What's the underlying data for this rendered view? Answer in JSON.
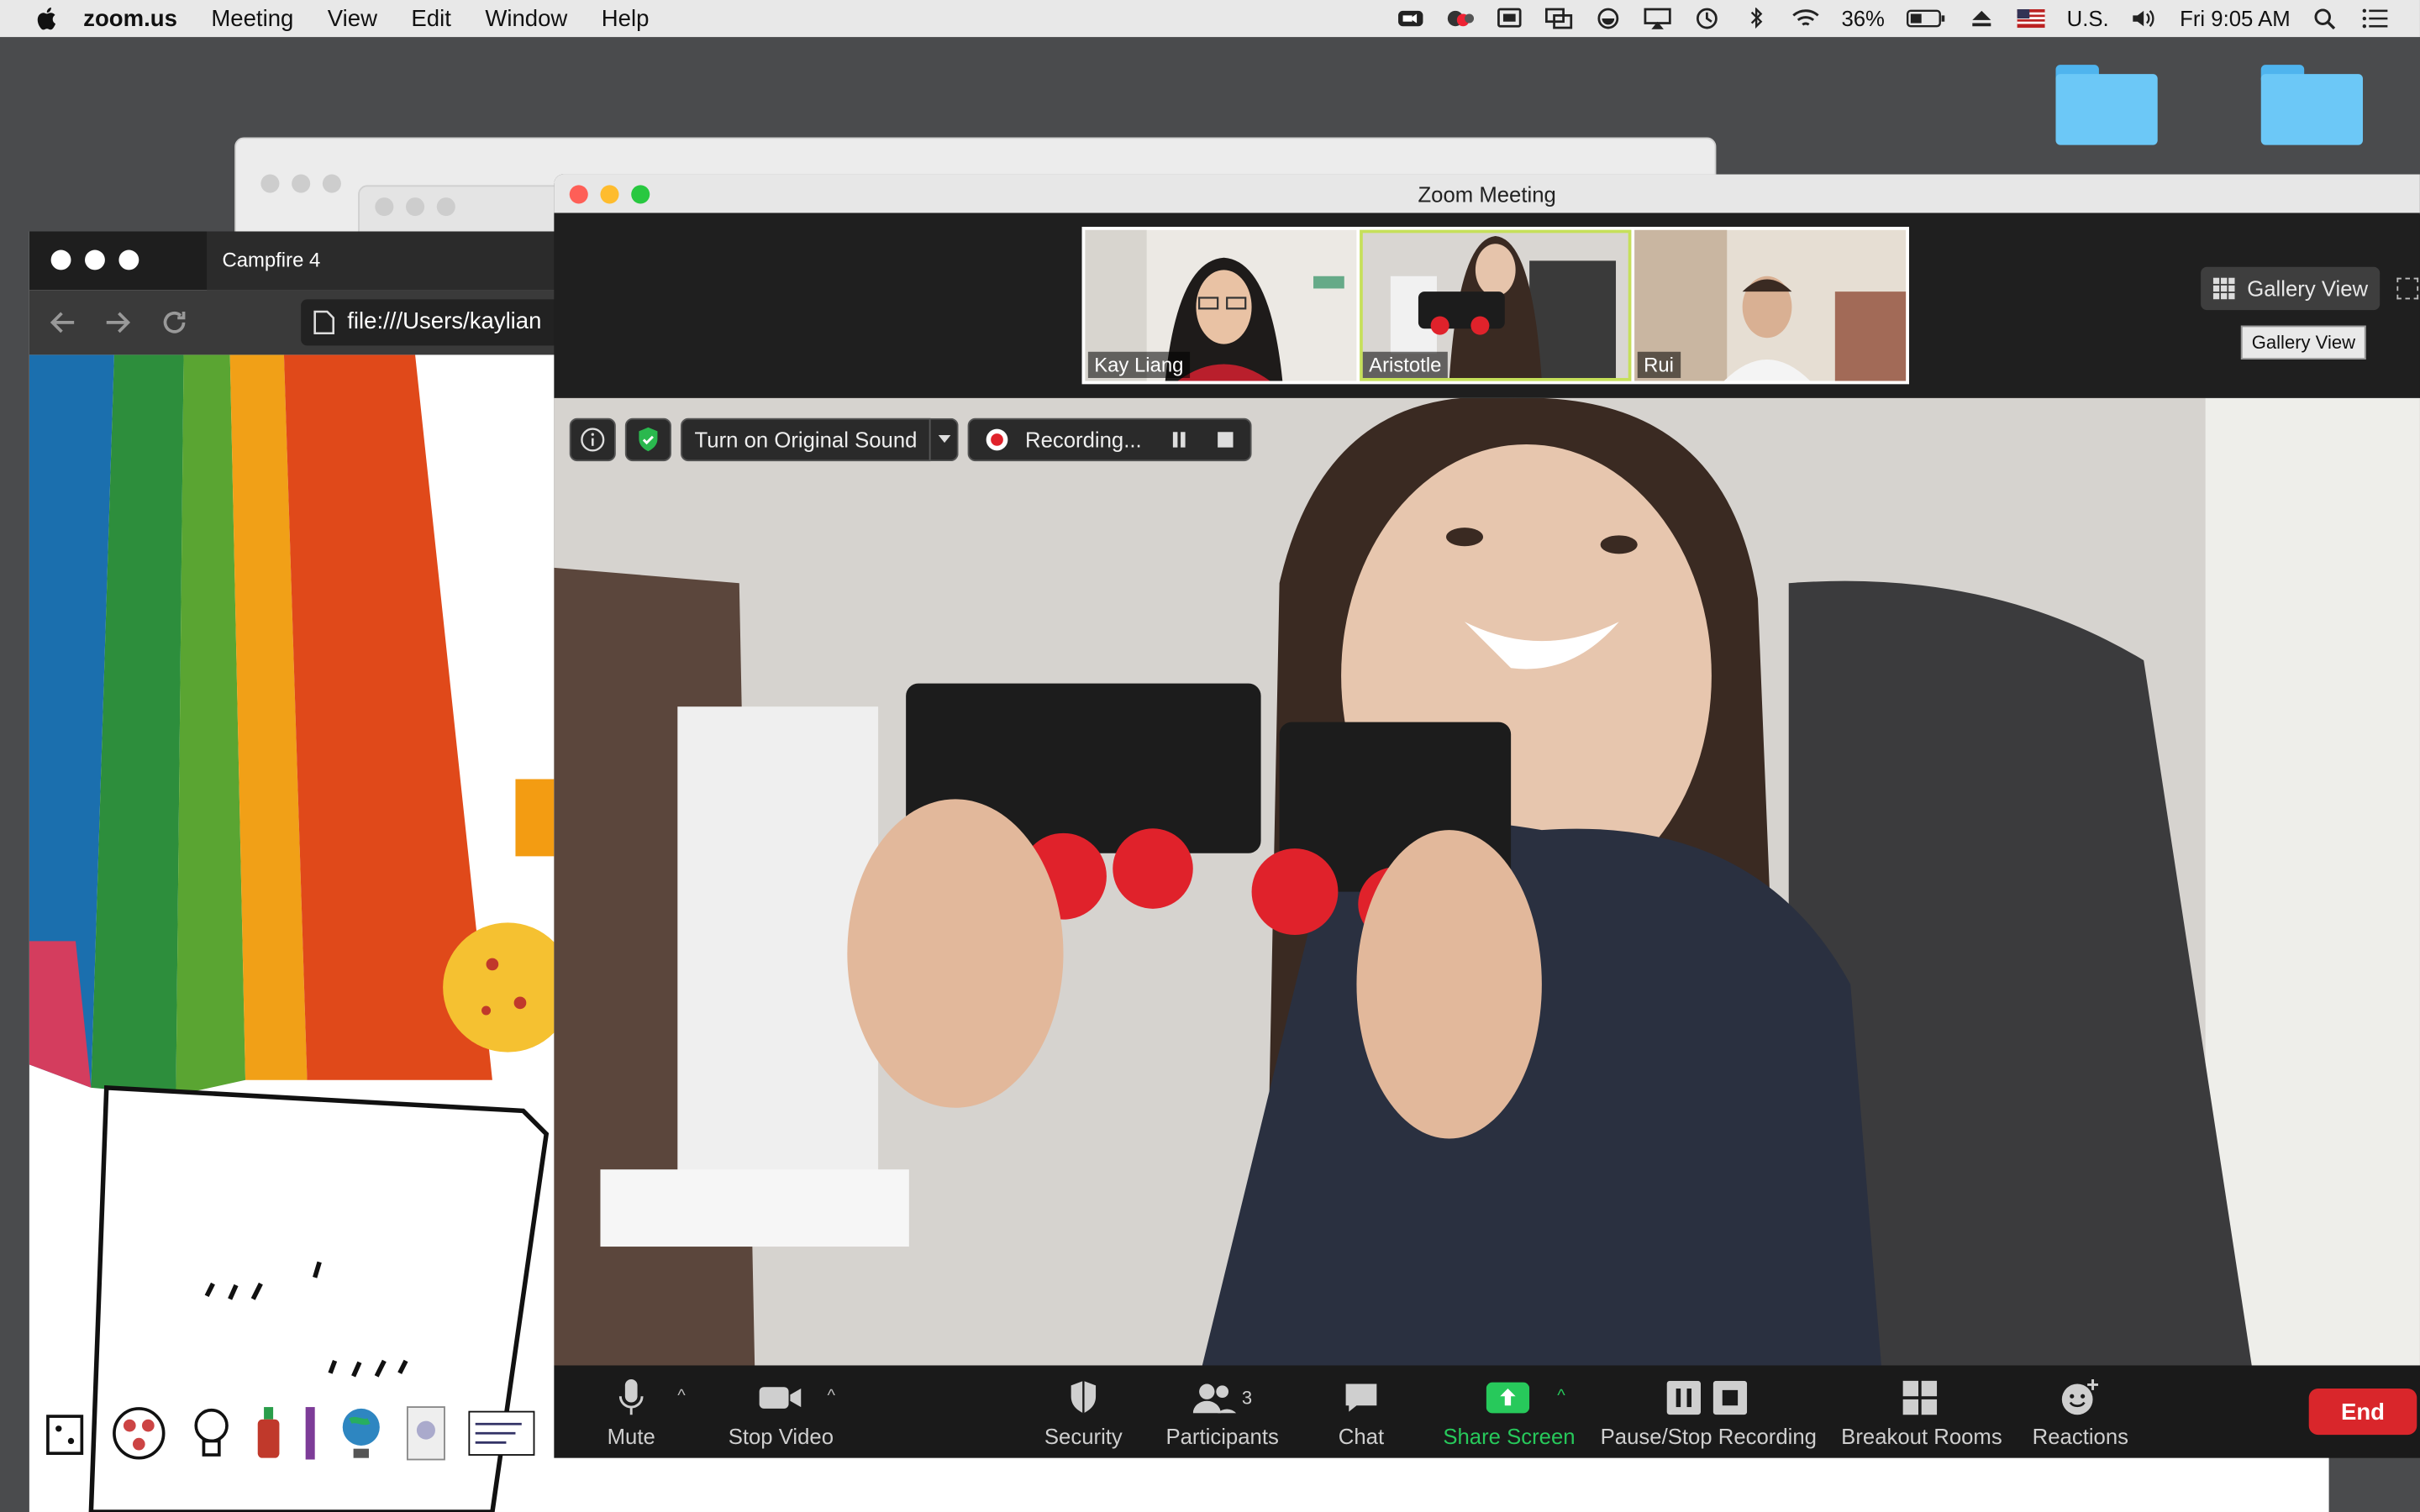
{
  "menubar": {
    "app": "zoom.us",
    "items": [
      "Meeting",
      "View",
      "Edit",
      "Window",
      "Help"
    ],
    "battery": "36%",
    "input_source": "U.S.",
    "clock": "Fri 9:05 AM"
  },
  "browser": {
    "tab_title": "Campfire 4",
    "url": "file:///Users/kaylian"
  },
  "zoom": {
    "window_title": "Zoom Meeting",
    "participants": [
      {
        "name": "Kay Liang",
        "active": false
      },
      {
        "name": "Aristotle",
        "active": true
      },
      {
        "name": "Rui",
        "active": false
      }
    ],
    "gallery_view_label": "Gallery View",
    "gallery_view_tooltip": "Gallery View",
    "original_sound_label": "Turn on Original Sound",
    "recording_label": "Recording...",
    "toolbar": {
      "mute": "Mute",
      "stop_video": "Stop Video",
      "security": "Security",
      "participants": "Participants",
      "participants_count": "3",
      "chat": "Chat",
      "share_screen": "Share Screen",
      "pause_stop_recording": "Pause/Stop Recording",
      "breakout_rooms": "Breakout Rooms",
      "reactions": "Reactions",
      "end": "End"
    }
  },
  "colors": {
    "share_green": "#27c95b",
    "end_red": "#d9262b",
    "active_speaker": "#c6e05a"
  }
}
